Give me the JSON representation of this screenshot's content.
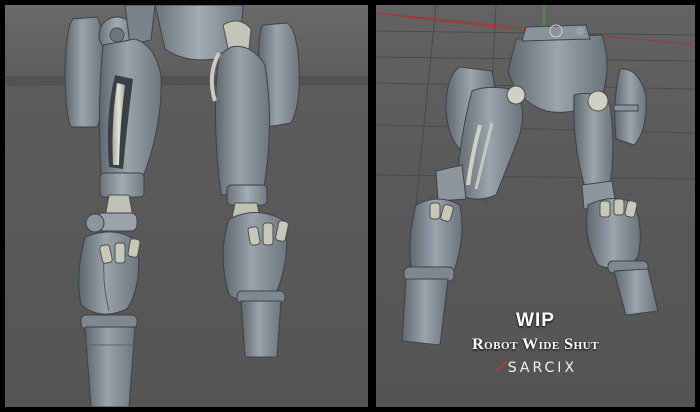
{
  "caption": {
    "title": "WIP",
    "subtitle": "Robot Wide Shut"
  },
  "logo": {
    "text": "SARCIX"
  },
  "views": [
    {
      "name": "front-view",
      "content": "robot legs"
    },
    {
      "name": "three-quarter-view",
      "content": "robot legs with pelvis"
    }
  ],
  "colors": {
    "frame": "#000000",
    "viewport_bg": "#5a5a5a",
    "model_gray": "#8a939c",
    "model_light": "#c9cbbf",
    "grid_line": "#404040",
    "axis_red": "#b03030",
    "axis_green": "#40a040",
    "logo_accent": "#d23030"
  }
}
